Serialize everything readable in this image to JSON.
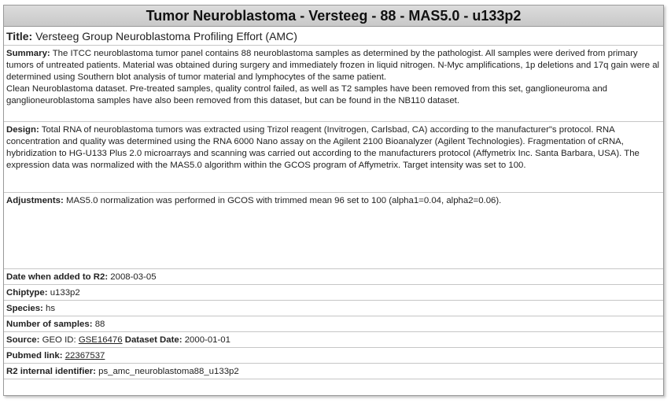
{
  "header": {
    "title": "Tumor Neuroblastoma - Versteeg - 88 - MAS5.0 - u133p2"
  },
  "title": {
    "label": "Title:",
    "value": "Versteeg Group Neuroblastoma Profiling Effort (AMC)"
  },
  "summary": {
    "label": "Summary:",
    "text1": "The ITCC neuroblastoma tumor panel contains 88 neuroblastoma samples as determined by the pathologist. All samples were derived from primary tumors of untreated patients. Material was obtained during surgery and immediately frozen in liquid nitrogen. N-Myc amplifications, 1p deletions and 17q gain were al determined using Southern blot analysis of tumor material and lymphocytes of the same patient.",
    "text2": "Clean Neuroblastoma dataset. Pre-treated samples, quality control failed, as well as T2 samples have been removed from this set, ganglioneuroma and ganglioneuroblastoma samples have also been removed from this dataset, but can be found in the NB110 dataset."
  },
  "design": {
    "label": "Design:",
    "text": "Total RNA of neuroblastoma tumors was extracted using Trizol reagent (Invitrogen, Carlsbad, CA) according to the manufacturer\"s protocol. RNA concentration and quality was determined using the RNA 6000 Nano assay on the Agilent 2100 Bioanalyzer (Agilent Technologies). Fragmentation of cRNA, hybridization to HG-U133 Plus 2.0 microarrays and scanning was carried out according to the manufacturers protocol (Affymetrix Inc. Santa Barbara, USA). The expression data was normalized with the MAS5.0 algorithm within the GCOS program of Affymetrix. Target intensity was set to 100."
  },
  "adjustments": {
    "label": "Adjustments:",
    "text": "MAS5.0 normalization was performed in GCOS with trimmed mean 96 set to 100 (alpha1=0.04, alpha2=0.06)."
  },
  "meta": {
    "date_label": "Date when added to R2:",
    "date_value": "2008-03-05",
    "chiptype_label": "Chiptype:",
    "chiptype_value": "u133p2",
    "species_label": "Species:",
    "species_value": "hs",
    "samples_label": "Number of samples:",
    "samples_value": "88",
    "source_label": "Source:",
    "source_prefix": "GEO ID:",
    "geo_id": "GSE16476",
    "dataset_date_label": "Dataset Date:",
    "dataset_date_value": "2000-01-01",
    "pubmed_label": "Pubmed link:",
    "pubmed_value": "22367537",
    "r2id_label": "R2 internal identifier:",
    "r2id_value": "ps_amc_neuroblastoma88_u133p2"
  }
}
